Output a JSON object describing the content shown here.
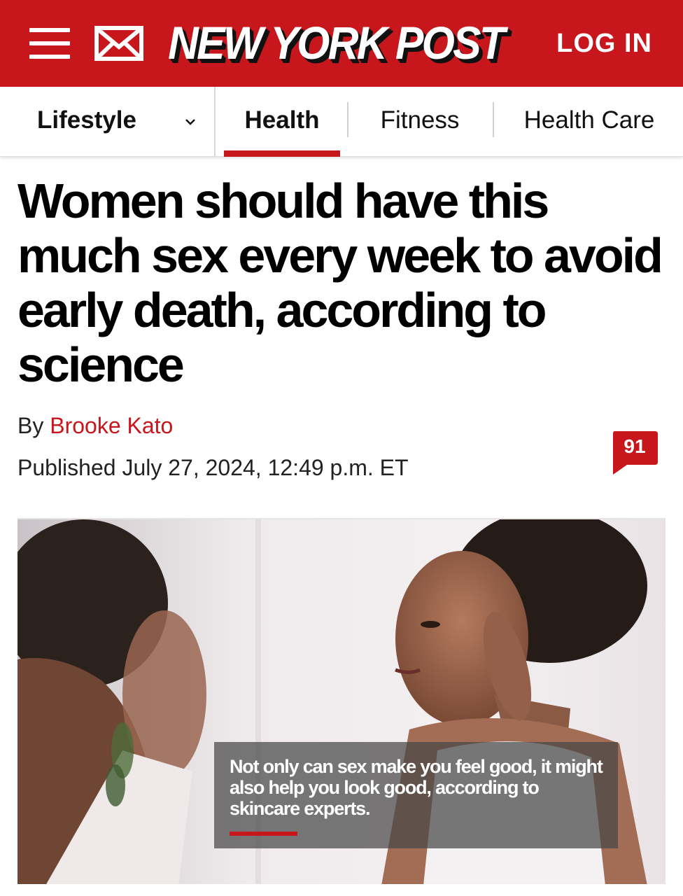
{
  "header": {
    "logo_text": "NEW YORK POST",
    "login_label": "LOG IN",
    "brand_color": "#c8161d",
    "menu_icon": "hamburger-menu-icon",
    "mail_icon": "mail-icon"
  },
  "nav": {
    "section_label": "Lifestyle",
    "section_icon": "chevron-down-icon",
    "tabs": [
      {
        "label": "Health",
        "active": true
      },
      {
        "label": "Fitness",
        "active": false
      },
      {
        "label": "Health Care",
        "active": false
      }
    ]
  },
  "article": {
    "headline": "Women should have this much sex every week to avoid early death, according to science",
    "byline_prefix": "By",
    "author": "Brooke Kato",
    "published": "Published July 27, 2024, 12:49 p.m. ET",
    "comment_count": "91",
    "image_caption": "Not only can sex make you feel good, it might also help you look good, according to skincare experts."
  }
}
